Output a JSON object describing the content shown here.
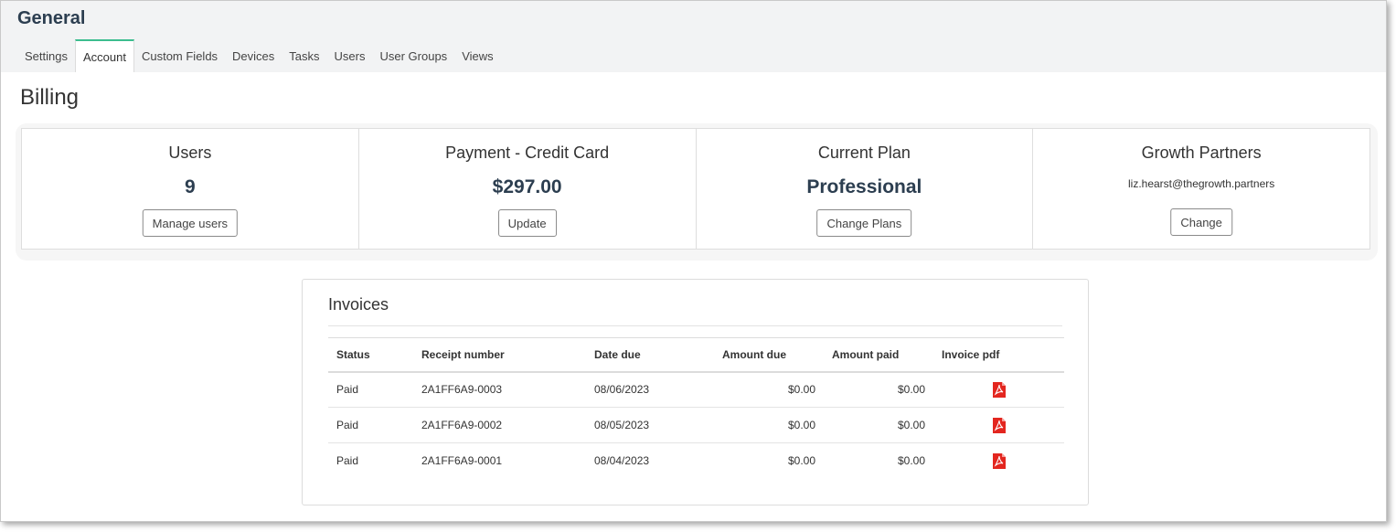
{
  "header": {
    "title": "General"
  },
  "tabs": [
    {
      "label": "Settings",
      "active": false
    },
    {
      "label": "Account",
      "active": true
    },
    {
      "label": "Custom Fields",
      "active": false
    },
    {
      "label": "Devices",
      "active": false
    },
    {
      "label": "Tasks",
      "active": false
    },
    {
      "label": "Users",
      "active": false
    },
    {
      "label": "User Groups",
      "active": false
    },
    {
      "label": "Views",
      "active": false
    }
  ],
  "billing": {
    "title": "Billing",
    "cards": {
      "users": {
        "title": "Users",
        "value": "9",
        "button": "Manage users"
      },
      "payment": {
        "title": "Payment - Credit Card",
        "value": "$297.00",
        "button": "Update"
      },
      "plan": {
        "title": "Current Plan",
        "value": "Professional",
        "button": "Change Plans"
      },
      "partner": {
        "title": "Growth Partners",
        "email": "liz.hearst@thegrowth.partners",
        "button": "Change"
      }
    }
  },
  "invoices": {
    "title": "Invoices",
    "columns": [
      "Status",
      "Receipt number",
      "Date due",
      "Amount due",
      "Amount paid",
      "Invoice pdf"
    ],
    "rows": [
      {
        "status": "Paid",
        "receipt": "2A1FF6A9-0003",
        "date_due": "08/06/2023",
        "amount_due": "$0.00",
        "amount_paid": "$0.00",
        "pdf_icon": "pdf-file-icon"
      },
      {
        "status": "Paid",
        "receipt": "2A1FF6A9-0002",
        "date_due": "08/05/2023",
        "amount_due": "$0.00",
        "amount_paid": "$0.00",
        "pdf_icon": "pdf-file-icon"
      },
      {
        "status": "Paid",
        "receipt": "2A1FF6A9-0001",
        "date_due": "08/04/2023",
        "amount_due": "$0.00",
        "amount_paid": "$0.00",
        "pdf_icon": "pdf-file-icon"
      }
    ]
  },
  "colors": {
    "tab_accent": "#3cbd8f",
    "heading_dark": "#2c3e50",
    "pdf_red": "#e3261f"
  }
}
